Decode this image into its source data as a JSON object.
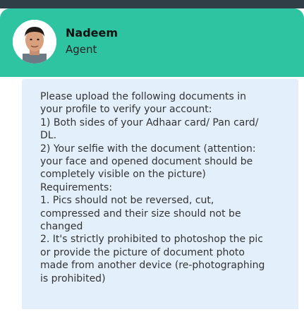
{
  "agent": {
    "name": "Nadeem",
    "role": "Agent",
    "avatar": "agent-avatar-photo"
  },
  "message": {
    "lines": [
      "Please upload the following documents in",
      "your profile to verify your account:",
      "1) Both sides of your Adhaar card/ Pan card/",
      "DL.",
      "2) Your selfie with the document (attention:",
      "your face and opened document should be",
      "completely visible on the picture)",
      "Requirements:",
      "1. Pics should not be reversed, cut,",
      "compressed and their size should not be",
      "changed",
      "2. It's strictly prohibited to photoshop the pic",
      "or provide the picture of document photo",
      "made from another device (re-photographing",
      "is prohibited)"
    ]
  },
  "colors": {
    "header": "#2ec3a1",
    "bubble": "#e3f0fc",
    "topstrip": "#2f3e47",
    "text": "#333333"
  }
}
